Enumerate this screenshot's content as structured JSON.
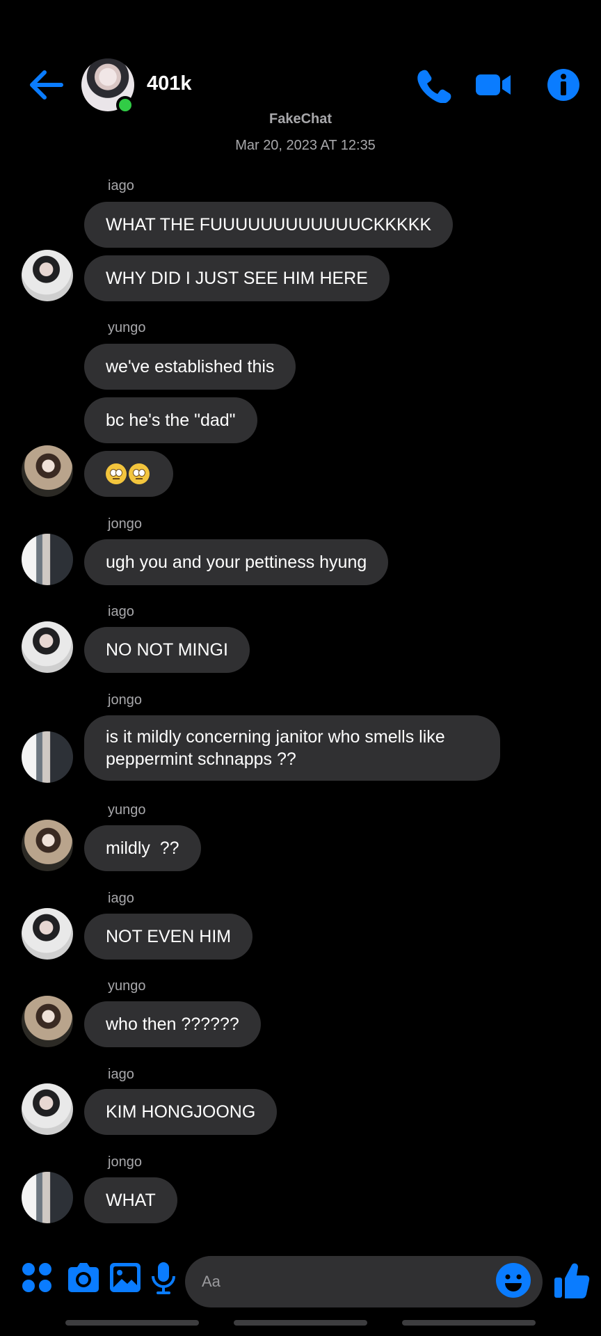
{
  "header": {
    "title": "401k",
    "group_name": "FakeChat",
    "timestamp": "Mar 20, 2023 AT 12:35",
    "icons": [
      "back-arrow-icon",
      "phone-icon",
      "video-camera-icon",
      "info-icon"
    ]
  },
  "colors": {
    "accent": "#0a7cff",
    "bubble": "#303032",
    "background": "#000000",
    "online": "#31cc46",
    "meta_text": "#a8a8ab"
  },
  "messages": {
    "s1": "iago",
    "m1": "WHAT THE FUUUUUUUUUUUUCKKKKK",
    "m2": "WHY DID I JUST SEE HIM HERE",
    "s2": "yungo",
    "m3": "we've established this",
    "m4": "bc he's the \"dad\"",
    "m5_emoji": "face-with-rolling-eyes x2",
    "s3": "jongo",
    "m6": "ugh you and your pettiness hyung",
    "s4": "iago",
    "m7": "NO NOT MINGI",
    "s5": "jongo",
    "m8": "is it mildly concerning janitor who smells like peppermint schnapps ??",
    "s6": "yungo",
    "m9": "mildly  ??",
    "s7": "iago",
    "m10": "NOT EVEN HIM",
    "s8": "yungo",
    "m11": "who then ??????",
    "s9": "iago",
    "m12": "KIM HONGJOONG",
    "s10": "jongo",
    "m13": "WHAT"
  },
  "composer": {
    "placeholder": "Aa",
    "icons": [
      "apps-grid-icon",
      "camera-icon",
      "gallery-icon",
      "microphone-icon",
      "emoji-icon",
      "thumbs-up-icon"
    ]
  }
}
